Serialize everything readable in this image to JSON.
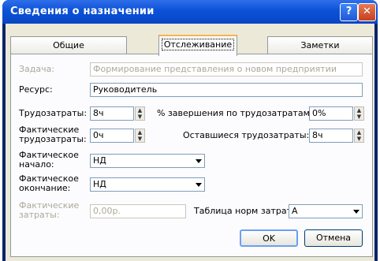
{
  "window": {
    "title": "Сведения о назначении"
  },
  "titlebar": {
    "help": "?",
    "close": "✕"
  },
  "tabs": [
    {
      "label": "Общие"
    },
    {
      "label": "Отслеживание"
    },
    {
      "label": "Заметки"
    }
  ],
  "task": {
    "label": "Задача:",
    "value": "Формирование представления о новом предприятии"
  },
  "resource": {
    "label": "Ресурс:",
    "value": "Руководитель"
  },
  "work": {
    "label": "Трудозатраты:",
    "value": "8ч"
  },
  "pct_work_complete": {
    "label": "% завершения по трудозатратам:",
    "value": "0%"
  },
  "actual_work": {
    "label": "Фактические трудозатраты:",
    "value": "0ч"
  },
  "remaining_work": {
    "label": "Оставшиеся трудозатраты:",
    "value": "8ч"
  },
  "actual_start": {
    "label": "Фактическое начало:",
    "value": "НД"
  },
  "actual_finish": {
    "label": "Фактическое окончание:",
    "value": "НД"
  },
  "actual_cost": {
    "label": "Фактические затраты:",
    "value": "0,00р."
  },
  "rate_table": {
    "label": "Таблица норм затрат:",
    "value": "A"
  },
  "buttons": {
    "ok": "OK",
    "cancel": "Отмена"
  }
}
